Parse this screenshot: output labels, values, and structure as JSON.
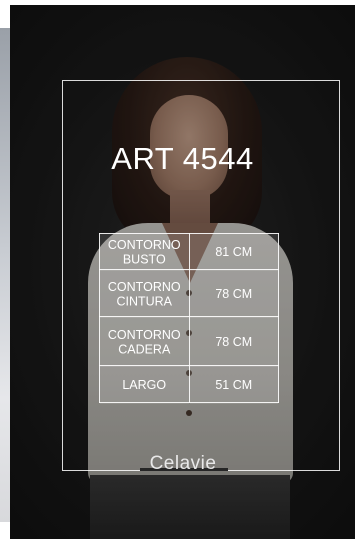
{
  "product": {
    "title": "ART 4544",
    "brand": "Celavie",
    "measurements": [
      {
        "label_line1": "CONTORNO",
        "label_line2": "BUSTO",
        "value": "81 CM"
      },
      {
        "label_line1": "CONTORNO",
        "label_line2": "CINTURA",
        "value": "78 CM"
      },
      {
        "label_line1": "CONTORNO",
        "label_line2": "CADERA",
        "value": "78 CM"
      },
      {
        "label_line1": "LARGO",
        "label_line2": "",
        "value": "51 CM"
      }
    ]
  },
  "colors": {
    "background": "#1b1b1b",
    "text": "#ffffff",
    "frame": "#ffffff"
  }
}
